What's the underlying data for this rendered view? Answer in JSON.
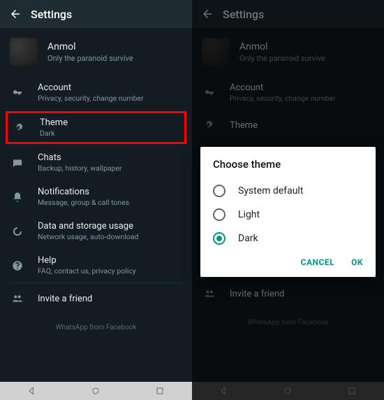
{
  "appbar": {
    "title": "Settings"
  },
  "profile": {
    "name": "Anmol",
    "status": "Only the paranoid survive"
  },
  "rows": {
    "account": {
      "title": "Account",
      "sub": "Privacy, security, change number"
    },
    "theme": {
      "title": "Theme",
      "sub": "Dark"
    },
    "chats": {
      "title": "Chats",
      "sub": "Backup, history, wallpaper"
    },
    "notif": {
      "title": "Notifications",
      "sub": "Message, group & call tones"
    },
    "data": {
      "title": "Data and storage usage",
      "sub": "Network usage, auto-download"
    },
    "help": {
      "title": "Help",
      "sub": "FAQ, contact us, privacy policy"
    },
    "invite": {
      "title": "Invite a friend"
    }
  },
  "footer": "WhatsApp from Facebook",
  "dialog": {
    "title": "Choose theme",
    "options": [
      "System default",
      "Light",
      "Dark"
    ],
    "selected_index": 2,
    "cancel": "CANCEL",
    "ok": "OK"
  }
}
